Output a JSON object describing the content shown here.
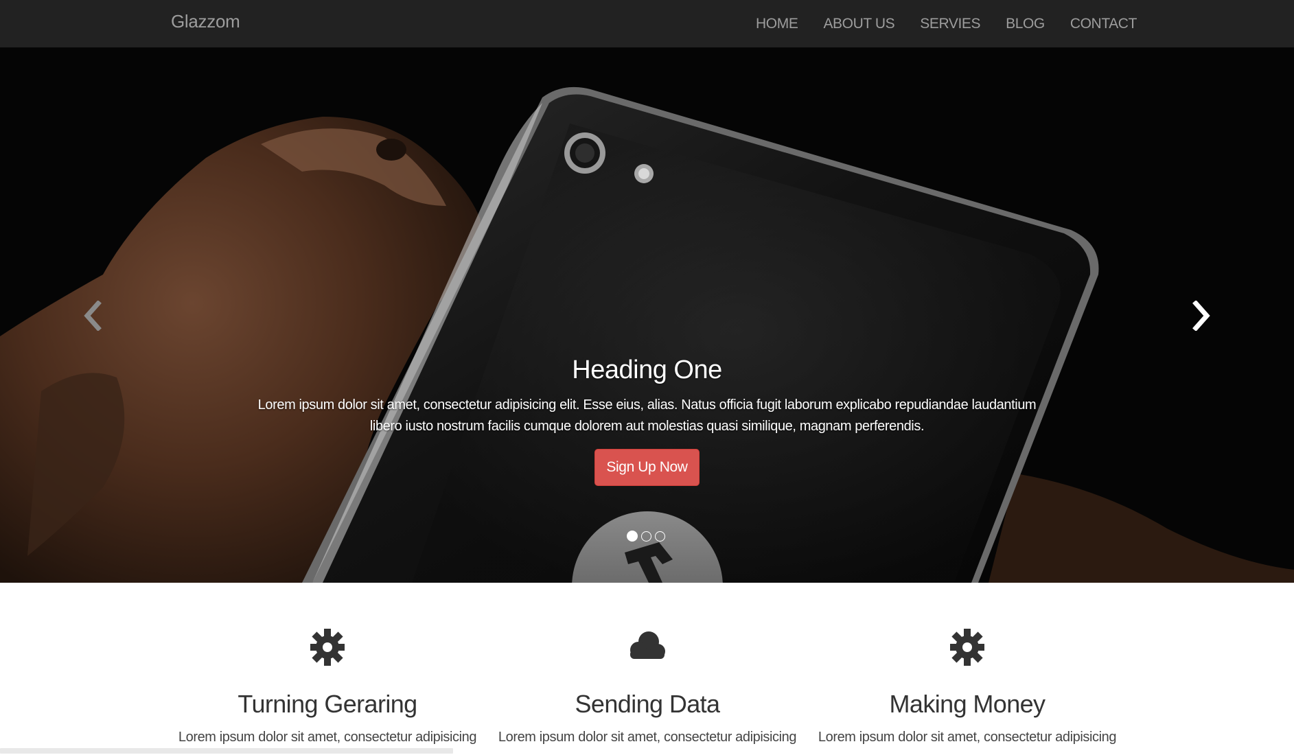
{
  "navbar": {
    "brand": "Glazzom",
    "links": [
      "HOME",
      "ABOUT US",
      "SERVIES",
      "BLOG",
      "CONTACT"
    ]
  },
  "hero": {
    "heading": "Heading One",
    "text": "Lorem ipsum dolor sit amet, consectetur adipisicing elit. Esse eius, alias. Natus officia fugit laborum explicabo repudiandae laudantium libero iusto nostrum facilis cumque dolorem aut molestias quasi similique, magnam perferendis.",
    "button_label": "Sign Up Now",
    "slides": 3,
    "active_slide": 1
  },
  "features": [
    {
      "icon": "gear-icon",
      "title": "Turning Geraring",
      "text": "Lorem ipsum dolor sit amet, consectetur adipisicing"
    },
    {
      "icon": "cloud-icon",
      "title": "Sending Data",
      "text": "Lorem ipsum dolor sit amet, consectetur adipisicing"
    },
    {
      "icon": "gear-icon",
      "title": "Making Money",
      "text": "Lorem ipsum dolor sit amet, consectetur adipisicing"
    }
  ],
  "colors": {
    "navbar_bg": "#222222",
    "nav_text": "#9d9d9d",
    "button_bg": "#d9534f"
  }
}
